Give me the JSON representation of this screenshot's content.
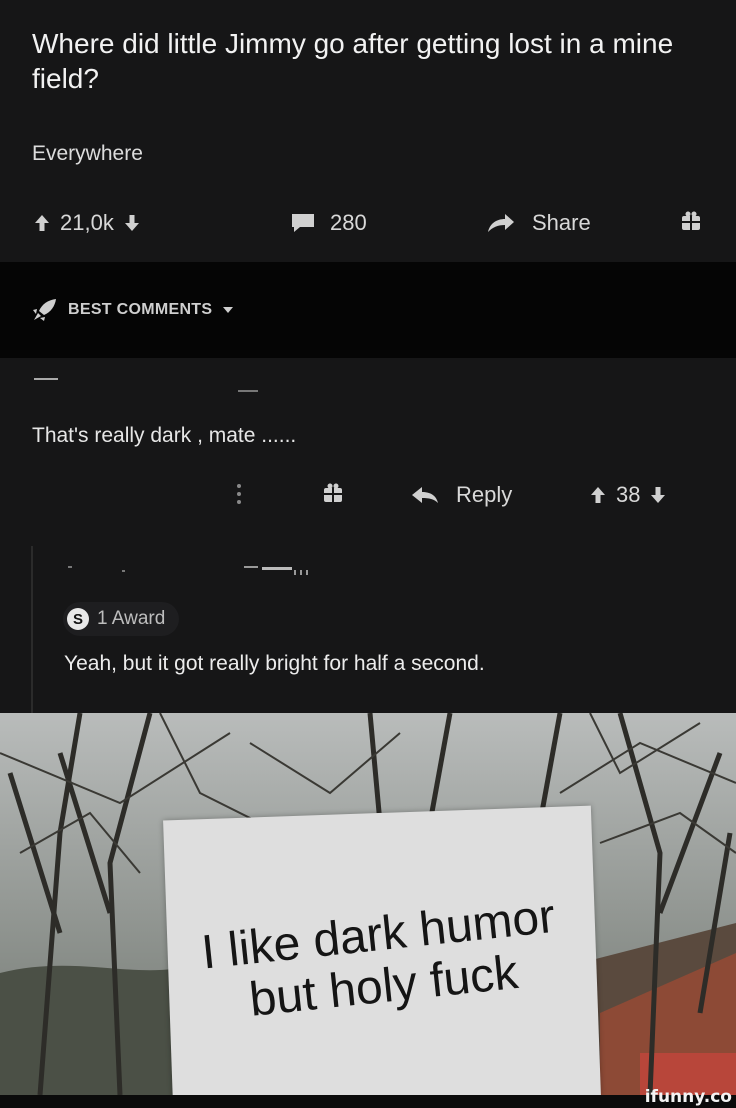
{
  "post": {
    "title": "Where did little Jimmy go after getting lost in a mine field?",
    "body": "Everywhere",
    "upvotes": "21,0k",
    "comments": "280",
    "share_label": "Share"
  },
  "best_comments": {
    "label": "BEST COMMENTS"
  },
  "comments": [
    {
      "text": "That's really dark , mate ......",
      "reply_label": "Reply",
      "score": "38"
    },
    {
      "award_icon": "S",
      "award_label": "1 Award",
      "text": "Yeah, but it got really bright for half a second."
    }
  ],
  "meme": {
    "line1": "I like dark humor",
    "line2": "but holy fuck"
  },
  "watermark": "ifunny.co",
  "colors": {
    "background": "#161617",
    "bar": "#050505",
    "text": "#e4e4e4"
  },
  "icons": [
    "upvote-icon",
    "downvote-icon",
    "comment-icon",
    "share-icon",
    "gift-icon",
    "rocket-icon",
    "chevron-down-icon",
    "more-icon",
    "reply-icon",
    "award-icon"
  ]
}
